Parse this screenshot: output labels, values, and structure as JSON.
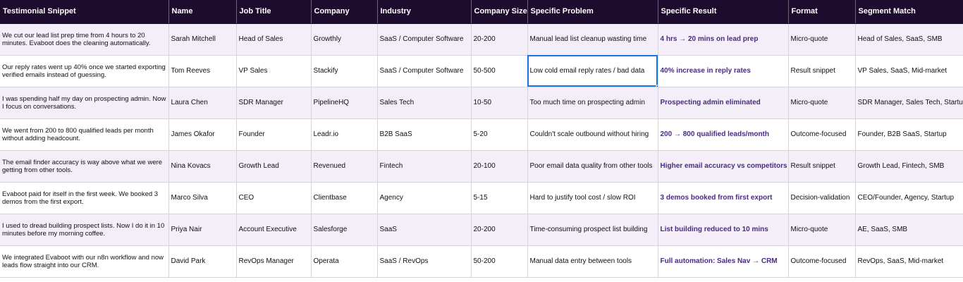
{
  "columns": [
    "Testimonial Snippet",
    "Name",
    "Job Title",
    "Company",
    "Industry",
    "Company Size",
    "Specific Problem",
    "Specific Result",
    "Format",
    "Segment Match"
  ],
  "rows": [
    {
      "snippet": "We cut our lead list prep time from 4 hours to 20 minutes. Evaboot does the cleaning automatically.",
      "name": "Sarah Mitchell",
      "title": "Head of Sales",
      "company": "Growthly",
      "industry": "SaaS / Computer Software",
      "size": "20-200",
      "problem": "Manual lead list cleanup wasting time",
      "result": "4 hrs → 20 mins on lead prep",
      "format": "Micro-quote",
      "segment": "Head of Sales, SaaS, SMB"
    },
    {
      "snippet": "Our reply rates went up 40% once we started exporting verified emails instead of guessing.",
      "name": "Tom Reeves",
      "title": "VP Sales",
      "company": "Stackify",
      "industry": "SaaS / Computer Software",
      "size": "50-500",
      "problem": "Low cold email reply rates / bad data",
      "result": "40% increase in reply rates",
      "format": "Result snippet",
      "segment": "VP Sales, SaaS, Mid-market"
    },
    {
      "snippet": "I was spending half my day on prospecting admin. Now I focus on conversations.",
      "name": "Laura Chen",
      "title": "SDR Manager",
      "company": "PipelineHQ",
      "industry": "Sales Tech",
      "size": "10-50",
      "problem": "Too much time on prospecting admin",
      "result": "Prospecting admin eliminated",
      "format": "Micro-quote",
      "segment": "SDR Manager, Sales Tech, Startup"
    },
    {
      "snippet": "We went from 200 to 800 qualified leads per month without adding headcount.",
      "name": "James Okafor",
      "title": "Founder",
      "company": "Leadr.io",
      "industry": "B2B SaaS",
      "size": "5-20",
      "problem": "Couldn't scale outbound without hiring",
      "result": "200 → 800 qualified leads/month",
      "format": "Outcome-focused",
      "segment": "Founder, B2B SaaS, Startup"
    },
    {
      "snippet": "The email finder accuracy is way above what we were getting from other tools.",
      "name": "Nina Kovacs",
      "title": "Growth Lead",
      "company": "Revenued",
      "industry": "Fintech",
      "size": "20-100",
      "problem": "Poor email data quality from other tools",
      "result": "Higher email accuracy vs competitors",
      "format": "Result snippet",
      "segment": "Growth Lead, Fintech, SMB"
    },
    {
      "snippet": "Evaboot paid for itself in the first week. We booked 3 demos from the first export.",
      "name": "Marco Silva",
      "title": "CEO",
      "company": "Clientbase",
      "industry": "Agency",
      "size": "5-15",
      "problem": "Hard to justify tool cost / slow ROI",
      "result": "3 demos booked from first export",
      "format": "Decision-validation",
      "segment": "CEO/Founder, Agency, Startup"
    },
    {
      "snippet": "I used to dread building prospect lists. Now I do it in 10 minutes before my morning coffee.",
      "name": "Priya Nair",
      "title": "Account Executive",
      "company": "Salesforge",
      "industry": "SaaS",
      "size": "20-200",
      "problem": "Time-consuming prospect list building",
      "result": "List building reduced to 10 mins",
      "format": "Micro-quote",
      "segment": "AE, SaaS, SMB"
    },
    {
      "snippet": "We integrated Evaboot with our n8n workflow and now leads flow straight into our CRM.",
      "name": "David Park",
      "title": "RevOps Manager",
      "company": "Operata",
      "industry": "SaaS / RevOps",
      "size": "50-200",
      "problem": "Manual data entry between tools",
      "result": "Full automation: Sales Nav → CRM",
      "format": "Outcome-focused",
      "segment": "RevOps, SaaS, Mid-market"
    }
  ],
  "selected_cell": {
    "row": 1,
    "column": "Specific Problem"
  },
  "colors": {
    "header_bg": "#1e0c2e",
    "header_text": "#ffffff",
    "band_row": "#f3eef8",
    "result_text": "#4a2a82",
    "selection": "#1a73e8"
  }
}
